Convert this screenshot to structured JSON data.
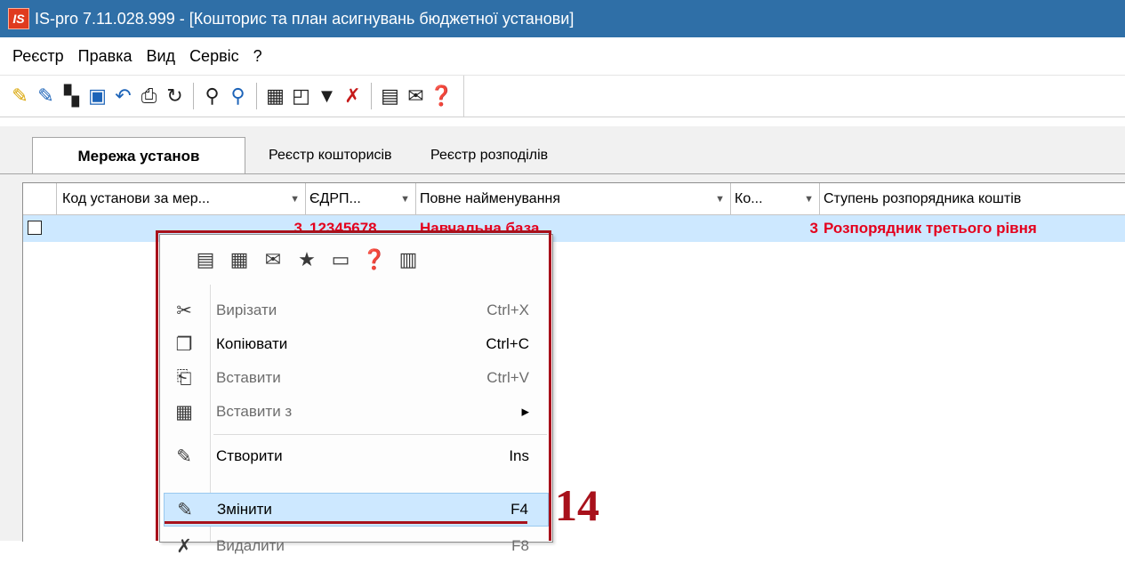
{
  "window": {
    "logo_text": "IS",
    "title": "IS-pro 7.11.028.999 - [Кошторис та  план асигнувань бюджетної установи]"
  },
  "menu": [
    "Реєстр",
    "Правка",
    "Вид",
    "Сервіс",
    "?"
  ],
  "toolbar": {
    "buttons": [
      {
        "name": "create-icon",
        "glyph": "✎"
      },
      {
        "name": "edit-icon",
        "glyph": "✎"
      },
      {
        "name": "delete-icon",
        "glyph": "▚"
      },
      {
        "name": "save-icon",
        "glyph": "▣"
      },
      {
        "name": "undo-icon",
        "glyph": "↶"
      },
      {
        "name": "print-icon",
        "glyph": "⎙"
      },
      {
        "name": "refresh-icon",
        "glyph": "↻"
      },
      {
        "name": "find-icon",
        "glyph": "⚲"
      },
      {
        "name": "find-next-icon",
        "glyph": "⚲"
      },
      {
        "name": "table-icon",
        "glyph": "▦"
      },
      {
        "name": "layout-icon",
        "glyph": "◰"
      },
      {
        "name": "filter-icon",
        "glyph": "▼"
      },
      {
        "name": "clear-filter-icon",
        "glyph": "✗"
      },
      {
        "name": "form-icon",
        "glyph": "▤"
      },
      {
        "name": "mail-icon",
        "glyph": "✉"
      },
      {
        "name": "help-icon",
        "glyph": "❓"
      }
    ]
  },
  "tabs": {
    "active": "Мережа установ",
    "second": "Реєстр кошторисів",
    "third": "Реєстр розподілів"
  },
  "grid": {
    "columns": {
      "code": "Код установи за мер...",
      "edrpou": "ЄДРП...",
      "full_name": "Повне найменування",
      "ko": "Ко...",
      "level": "Ступень розпорядника коштів"
    },
    "row": {
      "code": "3",
      "edrpou": "12345678",
      "full_name": "Навчальна база",
      "ko": "3",
      "level": "Розпорядник третього рівня"
    }
  },
  "context_menu": {
    "tools": [
      {
        "name": "calculator-icon",
        "glyph": "▤"
      },
      {
        "name": "calendar-icon",
        "glyph": "▦"
      },
      {
        "name": "mail-icon",
        "glyph": "✉"
      },
      {
        "name": "favorite-icon",
        "glyph": "★"
      },
      {
        "name": "form-icon",
        "glyph": "▭"
      },
      {
        "name": "help-icon",
        "glyph": "❓"
      },
      {
        "name": "columns-icon",
        "glyph": "▥"
      }
    ],
    "items": {
      "cut": {
        "label": "Вирізати",
        "key": "Ctrl+X"
      },
      "copy": {
        "label": "Копіювати",
        "key": "Ctrl+C"
      },
      "paste": {
        "label": "Вставити",
        "key": "Ctrl+V"
      },
      "paste_from": {
        "label": "Вставити з",
        "arrow": "▸"
      },
      "create": {
        "label": "Створити",
        "key": "Ins"
      },
      "edit": {
        "label": "Змінити",
        "key": "F4"
      },
      "delete": {
        "label": "Видалити",
        "key": "F8"
      }
    }
  },
  "annotation": {
    "step_number": "14",
    "color": "#a8111b"
  },
  "colors": {
    "titlebar": "#2f6fa7",
    "row_highlight": "#cde8ff",
    "row_text": "#e4001d"
  }
}
